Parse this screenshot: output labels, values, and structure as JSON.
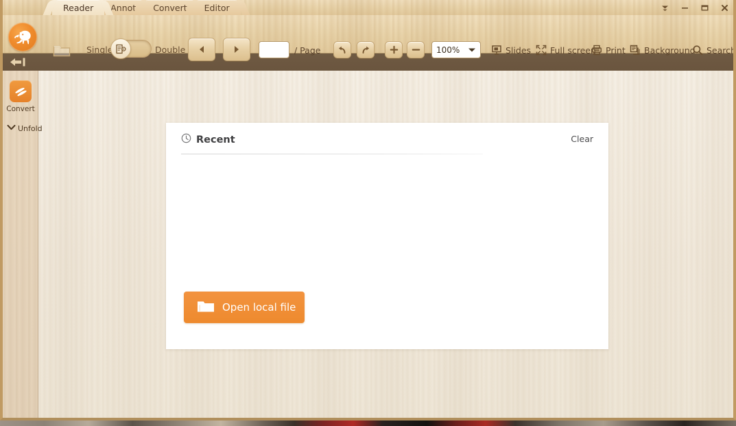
{
  "window": {
    "controls": [
      {
        "name": "window-menu",
        "glyph": "menu"
      },
      {
        "name": "minimize",
        "glyph": "minimize"
      },
      {
        "name": "maximize",
        "glyph": "maximize"
      },
      {
        "name": "close",
        "glyph": "close"
      }
    ]
  },
  "tabs": [
    {
      "label": "Reader",
      "active": true
    },
    {
      "label": "Annot",
      "active": false
    },
    {
      "label": "Convert",
      "active": false
    },
    {
      "label": "Editor",
      "active": false
    }
  ],
  "toolbar": {
    "logo_icon": "elephant-logo-icon",
    "open_folder_icon": "folder-open-icon",
    "single_label": "Single",
    "double_label": "Double",
    "page_mode": "single",
    "page_mode_icon": "page-view-icon",
    "prev_page_icon": "triangle-left-icon",
    "next_page_icon": "triangle-right-icon",
    "page_input_value": "",
    "page_input_placeholder": "",
    "page_total_label": "/ Page",
    "undo_icon": "undo-arrow-icon",
    "redo_icon": "redo-arrow-icon",
    "zoom_in_icon": "plus-icon",
    "zoom_out_icon": "minus-icon",
    "zoom_value": "100%",
    "zoom_options": [
      "100%"
    ],
    "items": [
      {
        "id": "slides",
        "label": "Slides",
        "icon": "slides-icon"
      },
      {
        "id": "fullscreen",
        "label": "Full screen",
        "icon": "fullscreen-icon"
      },
      {
        "id": "print",
        "label": "Print",
        "icon": "printer-icon"
      },
      {
        "id": "background",
        "label": "Background",
        "icon": "background-icon"
      },
      {
        "id": "search",
        "label": "Search",
        "icon": "search-icon"
      }
    ]
  },
  "collapse_bar": {
    "icon": "arrow-left-collapse-icon"
  },
  "sidebar": {
    "convert_label": "Convert",
    "convert_icon": "convert-icon",
    "unfold_label": "Unfold",
    "unfold_icon": "chevron-down-icon"
  },
  "recent_panel": {
    "title": "Recent",
    "title_icon": "clock-icon",
    "clear_label": "Clear",
    "items": [],
    "open_button_label": "Open local file",
    "open_button_icon": "folder-icon"
  },
  "colors": {
    "accent_orange": "#ee8a2e",
    "toolbar_wood": "#ead6ad",
    "content_wood": "#f1e9dc",
    "collapse_bar_brown": "#6a553e",
    "window_border": "#c09a62",
    "panel_white": "#ffffff",
    "text_dark": "#3f3f41",
    "text_brown": "#5b432c"
  }
}
